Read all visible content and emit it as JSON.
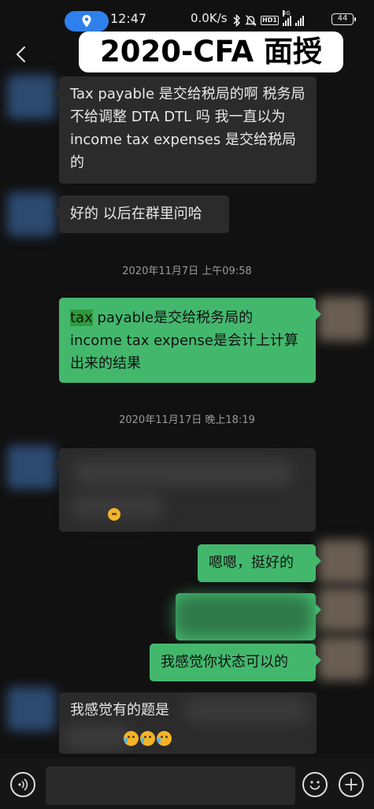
{
  "status": {
    "time": "12:47",
    "net_speed": "0.0K/s",
    "hd_badge": "HD1",
    "network_type": "4G",
    "battery": "44"
  },
  "banner": {
    "title": "2020-CFA 面授"
  },
  "timestamps": [
    "2020年11月7日 上午09:58",
    "2020年11月17日 晚上18:19"
  ],
  "messages": [
    {
      "dir": "in",
      "text": "Tax payable 是交给税局的啊 税务局不给调整 DTA DTL 吗 我一直以为 income tax expenses 是交给税局的"
    },
    {
      "dir": "in",
      "text": "好的 以后在群里问哈"
    },
    {
      "dir": "out",
      "highlight": "tax",
      "text": " payable是交给税务局的income tax expense是会计上计算出来的结果"
    },
    {
      "dir": "in",
      "text": "",
      "blurred": true
    },
    {
      "dir": "out",
      "text": "嗯嗯，挺好的"
    },
    {
      "dir": "out",
      "text": "",
      "blurred": true
    },
    {
      "dir": "out",
      "text": "我感觉你状态可以的"
    },
    {
      "dir": "in",
      "text": "我感觉有的题是",
      "partially_blurred": true
    }
  ],
  "icons": {
    "back": "chevron-left-icon",
    "location": "location-pin-icon",
    "voice": "voice-icon",
    "emoji": "emoji-icon",
    "plus": "plus-icon"
  },
  "colors": {
    "background": "#111111",
    "incoming_bubble": "#2b2b2b",
    "outgoing_bubble": "#43b86d",
    "location_pill": "#2f80ed"
  }
}
